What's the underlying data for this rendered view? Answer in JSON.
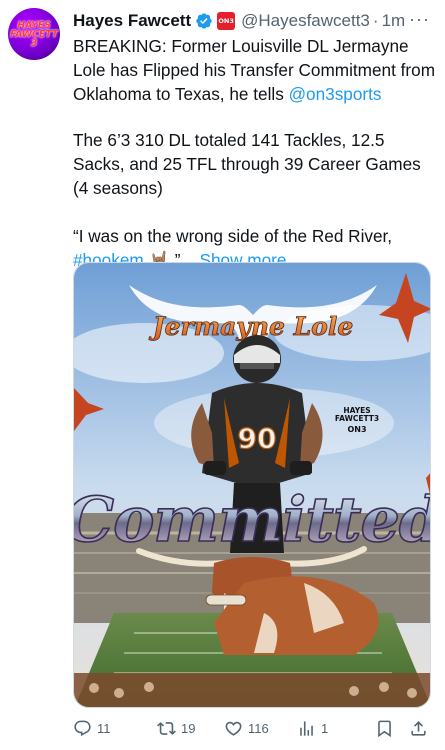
{
  "tweet": {
    "avatar_text": "HAYES\nFAWCETT\n3",
    "display_name": "Hayes Fawcett",
    "badge_text": "ON3",
    "handle": "@Hayesfawcett3",
    "separator": "·",
    "time": "1m",
    "more": "···",
    "line1": "BREAKING: Former Louisville DL Jermayne Lole has Flipped his Transfer Commitment from Oklahoma to Texas, he tells ",
    "mention": "@on3sports",
    "para2": "The 6’3 310 DL totaled 141 Tackles, 12.5 Sacks, and 25 TFL through 39 Career Games (4 seasons)",
    "para3_start": "“I was on the wrong side of the Red River, ",
    "hashtag": "#hookem",
    "emoji": "🤘🏽",
    "para3_end": "”...",
    "show_more": "Show more"
  },
  "media": {
    "script_name": "Jermayne Lole",
    "headline": "Committed",
    "watermark_line1": "HAYES",
    "watermark_line2": "FAWCETT3",
    "watermark_line3": "ON3",
    "jersey_number": "90"
  },
  "actions": {
    "replies": "11",
    "reposts": "19",
    "likes": "116",
    "views": "1"
  },
  "colors": {
    "link": "#1d9bf0",
    "text_secondary": "#536471",
    "verified": "#1d9bf0",
    "texas_orange": "#bf5700"
  }
}
